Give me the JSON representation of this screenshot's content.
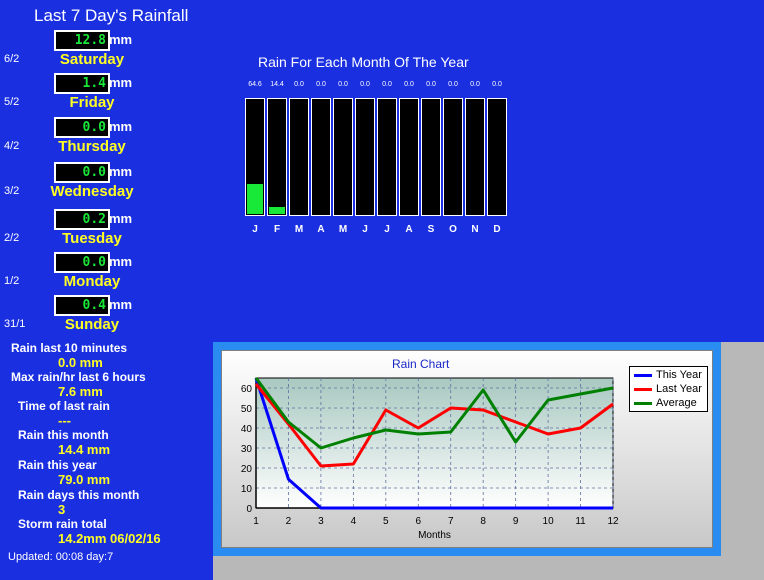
{
  "title": "Last 7 Day's Rainfall",
  "unit": "mm",
  "days": [
    {
      "date": "6/2",
      "value": "12.8",
      "name": "Saturday"
    },
    {
      "date": "5/2",
      "value": "1.4",
      "name": "Friday"
    },
    {
      "date": "4/2",
      "value": "0.0",
      "name": "Thursday"
    },
    {
      "date": "3/2",
      "value": "0.0",
      "name": "Wednesday"
    },
    {
      "date": "2/2",
      "value": "0.2",
      "name": "Tuesday"
    },
    {
      "date": "1/2",
      "value": "0.0",
      "name": "Monday"
    },
    {
      "date": "31/1",
      "value": "0.4",
      "name": "Sunday"
    }
  ],
  "stats": [
    {
      "label": "Rain last 10 minutes",
      "value": "0.0 mm"
    },
    {
      "label": "Max rain/hr last 6 hours",
      "value": "7.6 mm"
    },
    {
      "label": "Time of last rain",
      "value": "---"
    },
    {
      "label": "Rain this month",
      "value": "14.4 mm"
    },
    {
      "label": "Rain this year",
      "value": "79.0 mm"
    },
    {
      "label": "Rain days this month",
      "value": "3"
    },
    {
      "label": "Storm rain total",
      "value": "14.2mm 06/02/16"
    }
  ],
  "updated": "Updated: 00:08 day:7",
  "monthly": {
    "title": "Rain For Each Month Of The Year",
    "months": [
      "J",
      "F",
      "M",
      "A",
      "M",
      "J",
      "J",
      "A",
      "S",
      "O",
      "N",
      "D"
    ],
    "value_labels": [
      "64.6",
      "14.4",
      "0.0",
      "0.0",
      "0.0",
      "0.0",
      "0.0",
      "0.0",
      "0.0",
      "0.0",
      "0.0",
      "0.0"
    ],
    "values": [
      64.6,
      14.4,
      0,
      0,
      0,
      0,
      0,
      0,
      0,
      0,
      0,
      0
    ],
    "max": 250
  },
  "chart_data": {
    "type": "line",
    "title": "Rain Chart",
    "xlabel": "Months",
    "ylabel": "",
    "x": [
      1,
      2,
      3,
      4,
      5,
      6,
      7,
      8,
      9,
      10,
      11,
      12
    ],
    "xlim": [
      1,
      12
    ],
    "ylim": [
      0,
      65
    ],
    "yticks": [
      0,
      10,
      20,
      30,
      40,
      50,
      60
    ],
    "grid": true,
    "legend": "top-right",
    "series": [
      {
        "name": "This Year",
        "color": "#0000ff",
        "values": [
          65,
          14.4,
          0,
          0,
          0,
          0,
          0,
          0,
          0,
          0,
          0,
          0
        ]
      },
      {
        "name": "Last Year",
        "color": "#ff0000",
        "values": [
          62,
          42,
          21,
          22,
          49,
          40,
          50,
          49,
          43,
          37,
          40,
          52
        ]
      },
      {
        "name": "Average",
        "color": "#008000",
        "values": [
          65,
          43,
          30,
          35,
          39,
          37,
          38,
          59,
          33,
          54,
          57,
          60
        ]
      }
    ]
  }
}
